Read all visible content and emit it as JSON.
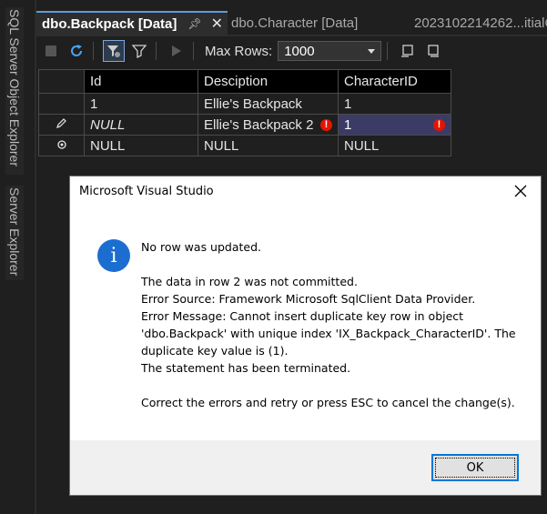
{
  "side_panels": {
    "object_explorer": "SQL Server Object Explorer",
    "server_explorer": "Server Explorer"
  },
  "tabs": [
    {
      "label": "dbo.Backpack [Data]",
      "active": true
    },
    {
      "label": "dbo.Character [Data]",
      "active": false
    },
    {
      "label": "2023102214262...itialC",
      "active": false
    }
  ],
  "toolbar": {
    "max_rows_label": "Max Rows:",
    "max_rows_value": "1000"
  },
  "grid": {
    "columns": [
      "Id",
      "Desciption",
      "CharacterID"
    ],
    "rows": [
      {
        "marker": "",
        "cells": [
          "1",
          "Ellie's Backpack",
          "1"
        ]
      },
      {
        "marker": "edit",
        "cells": [
          "NULL",
          "Ellie's Backpack 2",
          "1"
        ]
      },
      {
        "marker": "new",
        "cells": [
          "NULL",
          "NULL",
          "NULL"
        ]
      }
    ]
  },
  "dialog": {
    "title": "Microsoft Visual Studio",
    "heading": "No row was updated.",
    "line1": "The data in row 2 was not committed.",
    "line2": "Error Source: Framework Microsoft SqlClient Data Provider.",
    "line3": "Error Message: Cannot insert duplicate key row in object",
    "line4": "'dbo.Backpack' with unique index 'IX_Backpack_CharacterID'. The",
    "line5": "duplicate key value is (1).",
    "line6": "The statement has been terminated.",
    "footer_text": "Correct the errors and retry or press ESC to cancel the change(s).",
    "ok_label": "OK"
  },
  "colors": {
    "accent": "#5f9bd8",
    "error": "#e51400",
    "info_icon": "#1c6dd0",
    "selected_cell": "#3b3b66"
  }
}
